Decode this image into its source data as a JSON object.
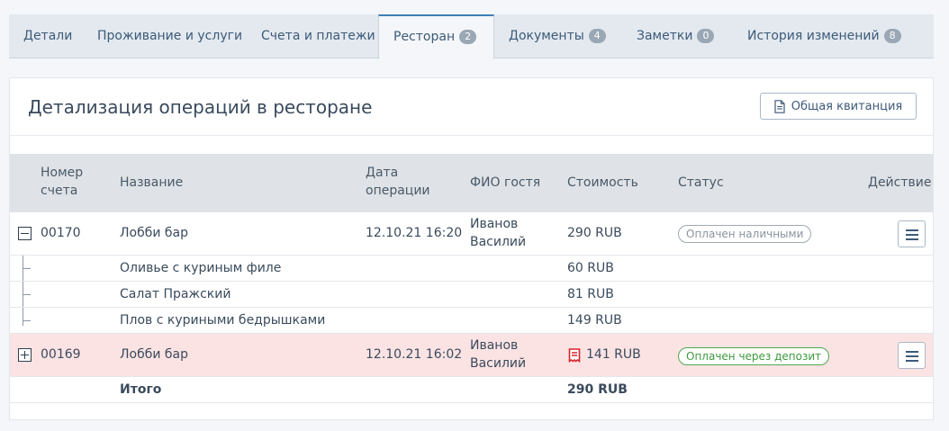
{
  "tabs": [
    {
      "label": "Детали"
    },
    {
      "label": "Проживание и услуги"
    },
    {
      "label": "Счета и платежи"
    },
    {
      "label": "Ресторан",
      "badge": "2"
    },
    {
      "label": "Документы",
      "badge": "4"
    },
    {
      "label": "Заметки",
      "badge": "0"
    },
    {
      "label": "История изменений",
      "badge": "8"
    }
  ],
  "panel": {
    "title": "Детализация операций в ресторане",
    "receipt_button": "Общая квитанция"
  },
  "table": {
    "headers": {
      "number": [
        "Номер",
        "счета"
      ],
      "name": "Название",
      "date": [
        "Дата",
        "операции"
      ],
      "guest": "ФИО гостя",
      "cost": "Стоимость",
      "status": "Статус",
      "action": "Действие"
    },
    "orders": [
      {
        "number": "00170",
        "name": "Лобби бар",
        "date": "12.10.21 16:20",
        "guest": [
          "Иванов",
          "Василий"
        ],
        "cost": "290 RUB",
        "status": "Оплачен наличными",
        "expanded": true,
        "items": [
          {
            "name": "Оливье с куриным филе",
            "cost": "60 RUB"
          },
          {
            "name": "Салат Пражский",
            "cost": "81 RUB"
          },
          {
            "name": "Плов с куриными бедрышками",
            "cost": "149 RUB"
          }
        ]
      },
      {
        "number": "00169",
        "name": "Лобби бар",
        "date": "12.10.21 16:02",
        "guest": [
          "Иванов",
          "Василий"
        ],
        "cost": "141 RUB",
        "status": "Оплачен через депозит",
        "expanded": false,
        "highlight_color": "#fbe3e3"
      }
    ],
    "total": {
      "label": "Итого",
      "cost": "290 RUB"
    }
  },
  "colors": {
    "accent": "#3f7fb8",
    "status_green": "#3e9a3e",
    "receipt_icon_red": "#d9242b"
  },
  "icons": {
    "receipt_button": "document-icon",
    "deposit": "receipt-icon",
    "row_action": "menu-icon"
  }
}
